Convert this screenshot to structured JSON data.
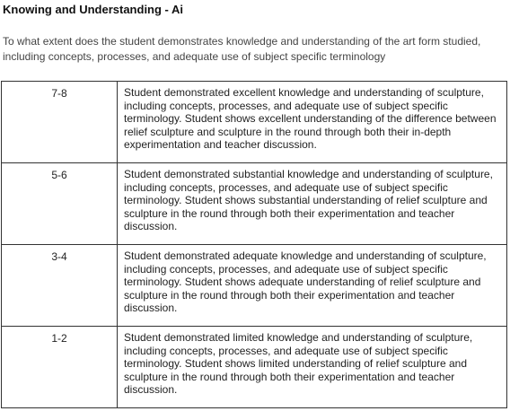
{
  "heading": "Knowing and Understanding - Ai",
  "question": "To what extent does the student demonstrates knowledge and understanding of the art form studied, including concepts, processes, and adequate use of subject specific terminology",
  "rubric": [
    {
      "score": "7-8",
      "description": "Student demonstrated excellent knowledge and understanding of sculpture, including concepts, processes, and adequate use of subject specific terminology. Student shows excellent understanding of the difference between relief sculpture and sculpture in the round through both their in-depth experimentation and teacher discussion."
    },
    {
      "score": "5-6",
      "description": "Student demonstrated substantial knowledge and understanding of sculpture, including concepts, processes, and adequate use of subject specific terminology. Student shows substantial understanding of relief sculpture and sculpture in the round through both their experimentation and teacher discussion."
    },
    {
      "score": "3-4",
      "description": "Student demonstrated adequate knowledge and understanding of sculpture, including concepts, processes, and adequate use of subject specific terminology. Student shows adequate understanding of relief sculpture and sculpture in the round through both their experimentation and teacher discussion."
    },
    {
      "score": "1-2",
      "description": "Student demonstrated limited knowledge and understanding of sculpture, including concepts, processes, and adequate use of subject specific terminology. Student shows limited understanding of relief sculpture and sculpture in the round through both their experimentation and teacher discussion."
    }
  ]
}
